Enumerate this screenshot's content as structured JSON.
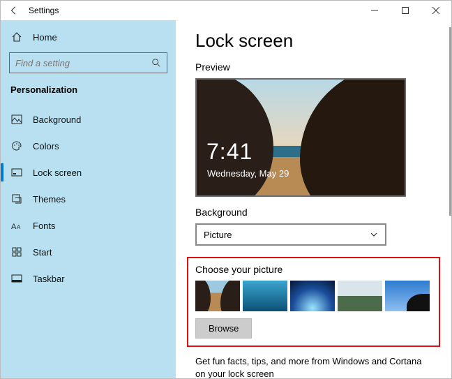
{
  "titlebar": {
    "title": "Settings"
  },
  "sidebar": {
    "home": "Home",
    "search_placeholder": "Find a setting",
    "section": "Personalization",
    "items": [
      {
        "label": "Background",
        "icon": "image-icon"
      },
      {
        "label": "Colors",
        "icon": "palette-icon"
      },
      {
        "label": "Lock screen",
        "icon": "lockscreen-icon",
        "selected": true
      },
      {
        "label": "Themes",
        "icon": "themes-icon"
      },
      {
        "label": "Fonts",
        "icon": "fonts-icon"
      },
      {
        "label": "Start",
        "icon": "start-icon"
      },
      {
        "label": "Taskbar",
        "icon": "taskbar-icon"
      }
    ]
  },
  "main": {
    "heading": "Lock screen",
    "preview_label": "Preview",
    "preview_time": "7:41",
    "preview_date": "Wednesday, May 29",
    "background_label": "Background",
    "background_value": "Picture",
    "choose_label": "Choose your picture",
    "browse_label": "Browse",
    "funfacts": "Get fun facts, tips, and more from Windows and Cortana on your lock screen"
  }
}
